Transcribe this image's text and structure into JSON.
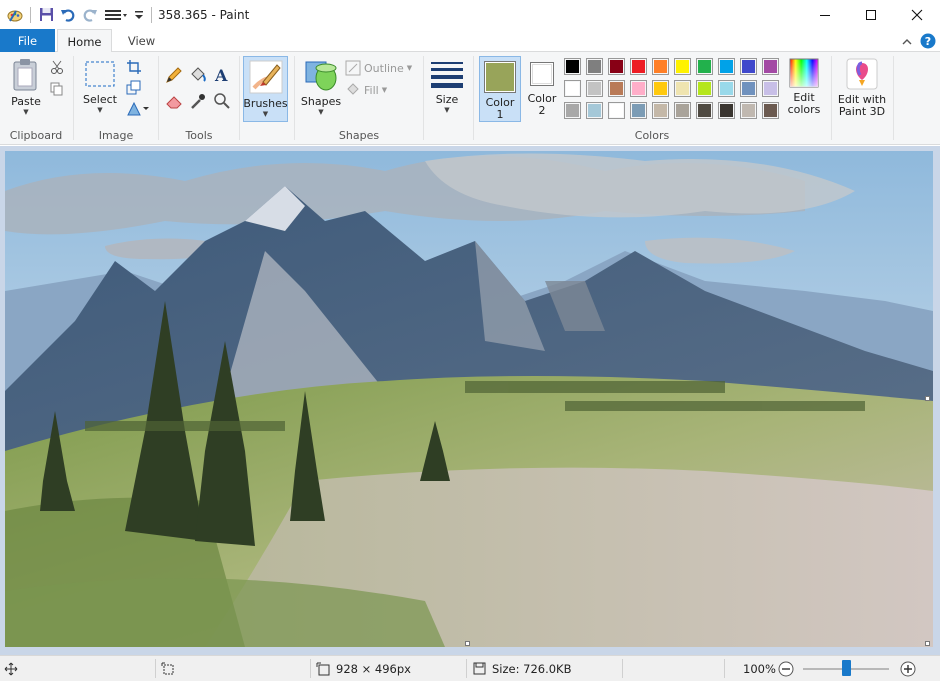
{
  "window": {
    "title": "358.365 - Paint",
    "controls": {
      "minimize": "minimize-icon",
      "maximize": "maximize-icon",
      "close": "close-icon"
    }
  },
  "tabs": {
    "file": "File",
    "home": "Home",
    "view": "View"
  },
  "ribbon": {
    "clipboard": {
      "label": "Clipboard",
      "paste": "Paste"
    },
    "image": {
      "label": "Image",
      "select": "Select"
    },
    "tools": {
      "label": "Tools"
    },
    "brushes": {
      "label": "Brushes"
    },
    "shapes": {
      "label": "Shapes",
      "shapes_btn": "Shapes",
      "outline": "Outline",
      "fill": "Fill"
    },
    "size": {
      "label": "Size"
    },
    "colors": {
      "label": "Colors",
      "color1_line1": "Color",
      "color1_line2": "1",
      "color2_line1": "Color",
      "color2_line2": "2",
      "color1_value": "#98a45a",
      "color2_value": "#ffffff",
      "edit_colors_line1": "Edit",
      "edit_colors_line2": "colors",
      "palette_row1": [
        "#000000",
        "#7f7f7f",
        "#880015",
        "#ed1c24",
        "#ff7f27",
        "#fff200",
        "#22b14c",
        "#00a2e8",
        "#3f48cc",
        "#a349a4"
      ],
      "palette_row2": [
        "#ffffff",
        "#c3c3c3",
        "#b97a57",
        "#ffaec9",
        "#ffc90e",
        "#efe4b0",
        "#b5e61d",
        "#99d9ea",
        "#7092be",
        "#c8bfe7"
      ],
      "palette_row3": [
        "#a8a8a8",
        "#a5c8d8",
        "#ffffff",
        "#7c9cb5",
        "#c4b8a8",
        "#a9a39a",
        "#4f4a42",
        "#3a3530",
        "#c0b8b0",
        "#6b5a50"
      ]
    },
    "paint3d": {
      "line1": "Edit with",
      "line2": "Paint 3D"
    }
  },
  "statusbar": {
    "dimensions": "928 × 496px",
    "size": "Size: 726.0KB",
    "zoom": "100%",
    "zoom_level_fraction": 0.5
  }
}
